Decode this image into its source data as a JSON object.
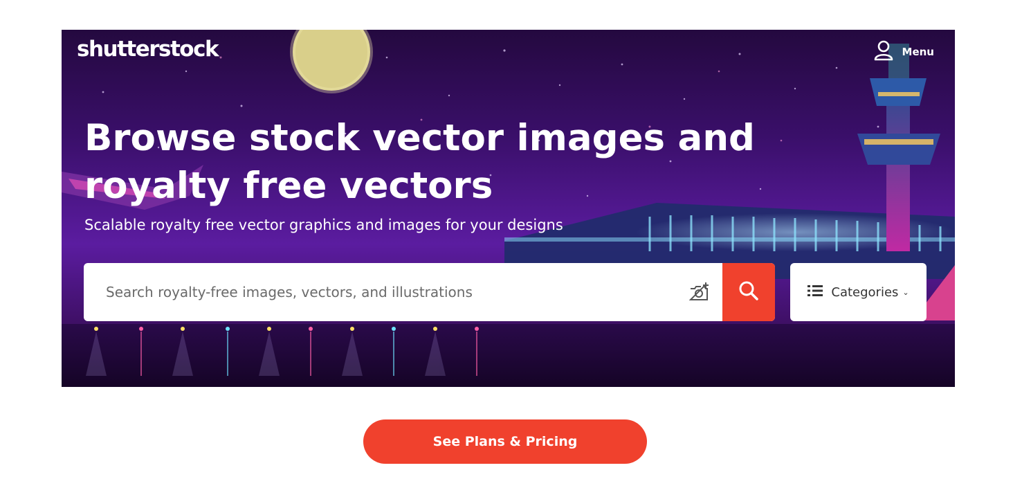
{
  "header": {
    "logo_text": "shutterstock",
    "menu_label": "Menu",
    "user_icon": "user-icon"
  },
  "hero": {
    "headline": "Browse stock vector images and royalty free vectors",
    "subheadline": "Scalable royalty free vector graphics and images for your designs",
    "illustration": "night-airport-illustration"
  },
  "search": {
    "placeholder": "Search royalty-free images, vectors, and illustrations",
    "value": "",
    "camera_icon": "camera-search-icon",
    "submit_icon": "search-icon"
  },
  "categories": {
    "label": "Categories",
    "icon": "list-icon",
    "chevron": "⌄"
  },
  "cta": {
    "label": "See Plans & Pricing"
  },
  "colors": {
    "accent": "#f0412d",
    "hero_purple": "#3a0f6a",
    "text_on_dark": "#ffffff"
  }
}
